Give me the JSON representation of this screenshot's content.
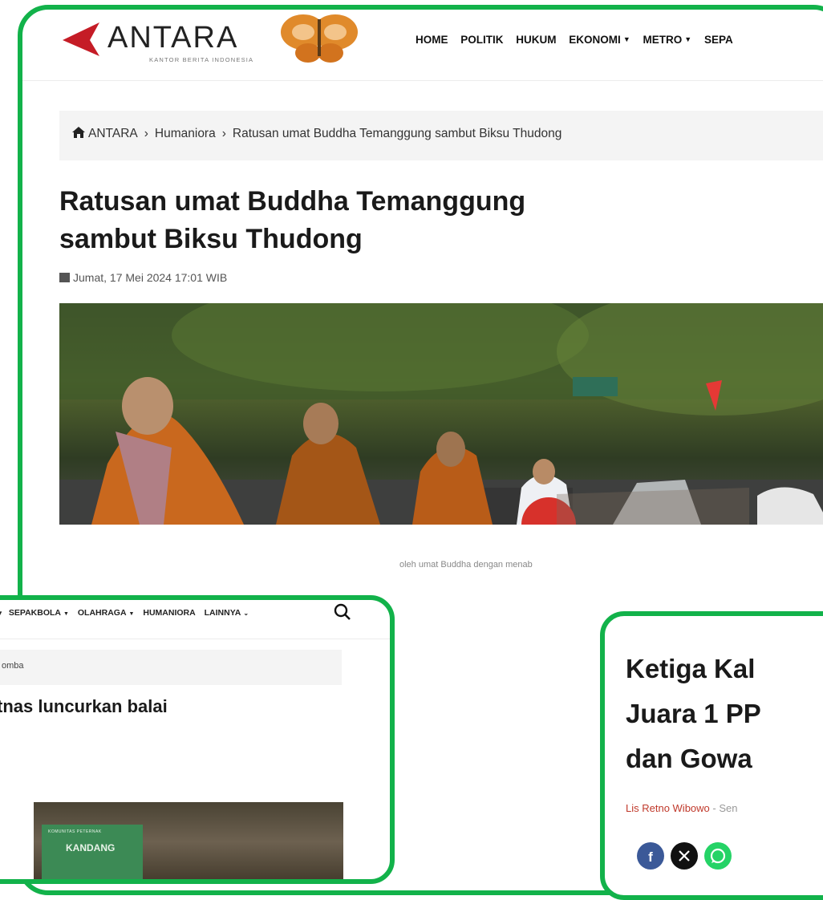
{
  "brand": {
    "name": "ANTARA",
    "tagline": "KANTOR BERITA INDONESIA",
    "accent": "#c51c26",
    "border_green": "#12b24a"
  },
  "nav": {
    "items": [
      {
        "label": "HOME",
        "dropdown": false
      },
      {
        "label": "POLITIK",
        "dropdown": false
      },
      {
        "label": "HUKUM",
        "dropdown": false
      },
      {
        "label": "EKONOMI",
        "dropdown": true
      },
      {
        "label": "METRO",
        "dropdown": true
      },
      {
        "label": "SEPA",
        "dropdown": false
      }
    ]
  },
  "breadcrumb": {
    "root": "ANTARA",
    "section": "Humaniora",
    "current": "Ratusan umat Buddha Temanggung sambut Biksu Thudong"
  },
  "article": {
    "title_line1": "Ratusan umat Buddha Temanggung",
    "title_line2": "sambut Biksu Thudong",
    "date": "Jumat, 17 Mei 2024 17:01 WIB",
    "caption": "oleh umat Buddha dengan menab"
  },
  "left_panel": {
    "nav": [
      "SEPAKBOLA",
      "OLAHRAGA",
      "HUMANIORA",
      "LAINNYA"
    ],
    "breadcrumb_tail": "omba",
    "title": "tnas luncurkan balai",
    "sign_top": "KOMUNITAS PETERNAK",
    "sign_main": "KANDANG"
  },
  "right_panel": {
    "title_line1": "Ketiga Kal",
    "title_line2": "Juara 1 PP",
    "title_line3": "dan Gowa",
    "author": "Lis Retno Wibowo",
    "meta": " - Sen",
    "share_colors": {
      "facebook": "#3b5998",
      "x": "#111111",
      "whatsapp": "#25d366"
    }
  }
}
